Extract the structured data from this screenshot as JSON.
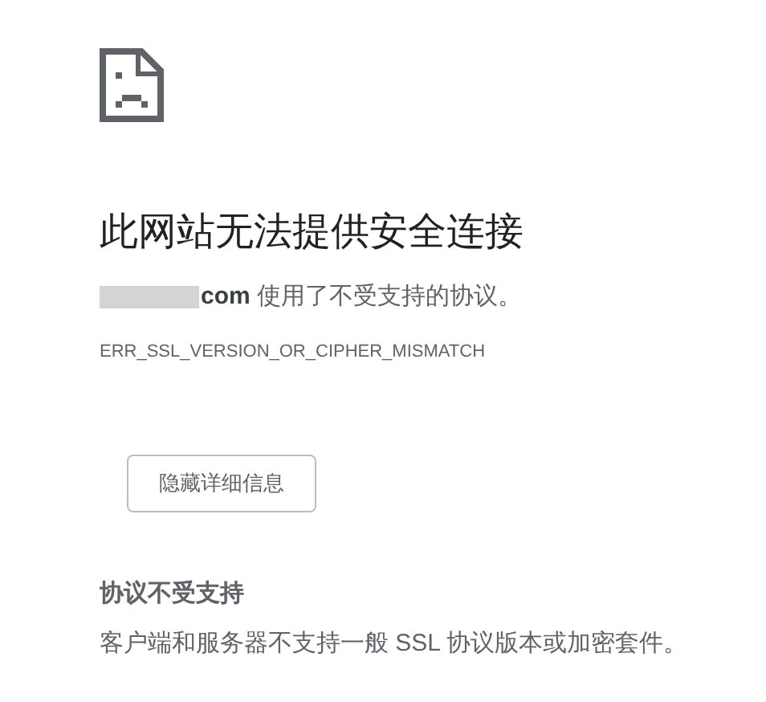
{
  "heading": "此网站无法提供安全连接",
  "message": "**com** 使用了不受支持的协议。",
  "error_code": "ERR_SSL_VERSION_OR_CIPHER_MISMATCH",
  "details_button": "隐藏详细信息",
  "details": {
    "title": "协议不受支持",
    "text": "客户端和服务器不支持一般 SSL 协议版本或加密套件。"
  }
}
